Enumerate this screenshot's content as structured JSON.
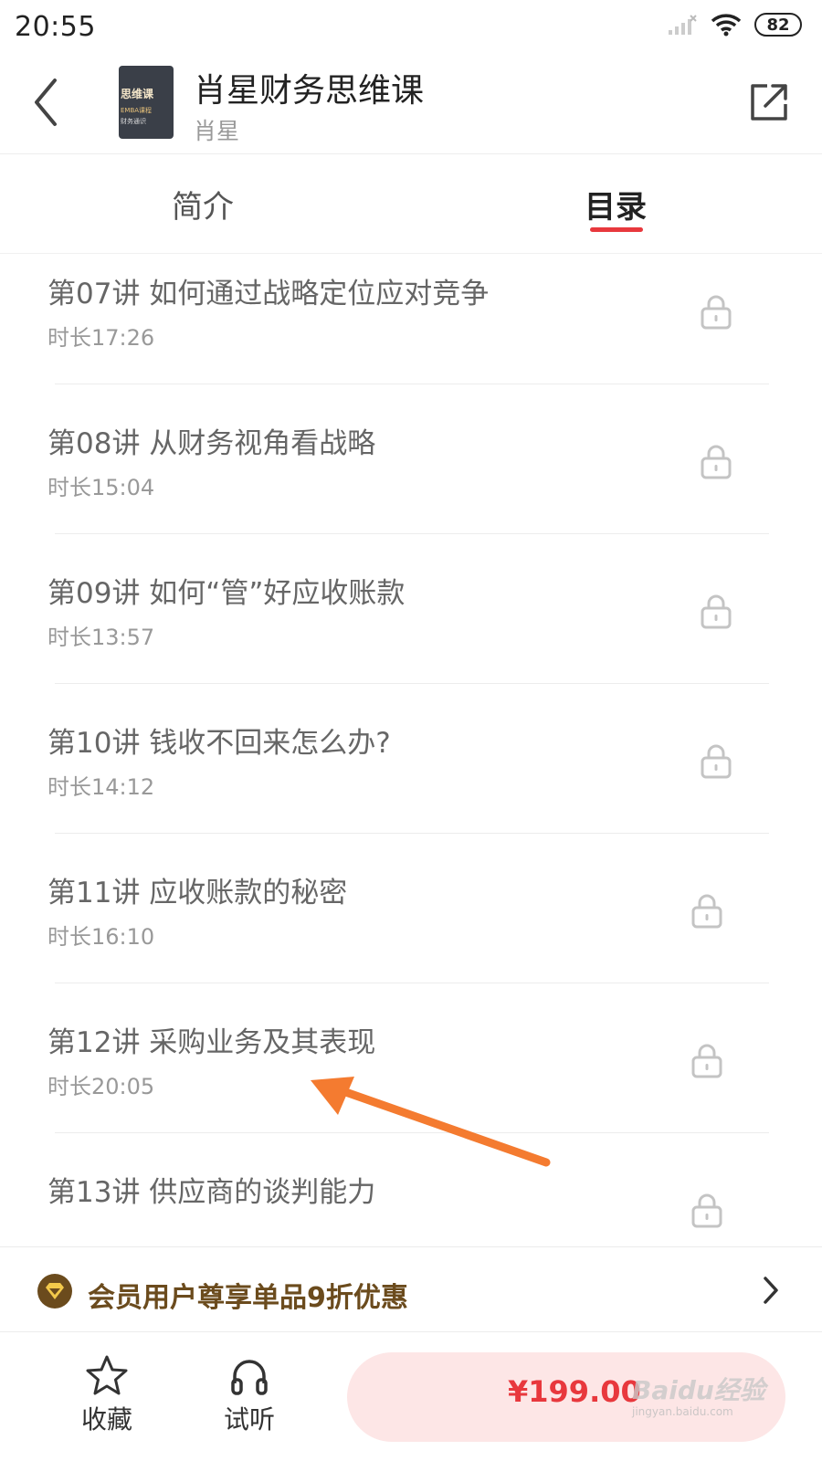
{
  "status_bar": {
    "time": "20:55",
    "battery": "82"
  },
  "header": {
    "title": "肖星财务思维课",
    "author": "肖星",
    "cover_lines": [
      "思维课",
      "EMBA课程",
      "财务通识"
    ]
  },
  "tabs": [
    {
      "label": "简介",
      "active": false
    },
    {
      "label": "目录",
      "active": true
    }
  ],
  "lessons": [
    {
      "title": "第07讲 如何通过战略定位应对竞争",
      "duration": "时长17:26",
      "locked": true
    },
    {
      "title": "第08讲 从财务视角看战略",
      "duration": "时长15:04",
      "locked": true
    },
    {
      "title": "第09讲 如何“管”好应收账款",
      "duration": "时长13:57",
      "locked": true
    },
    {
      "title": "第10讲 钱收不回来怎么办?",
      "duration": "时长14:12",
      "locked": true
    },
    {
      "title": "第11讲 应收账款的秘密",
      "duration": "时长16:10",
      "locked": true
    },
    {
      "title": "第12讲 采购业务及其表现",
      "duration": "时长20:05",
      "locked": true
    },
    {
      "title": "第13讲 供应商的谈判能力",
      "duration": "",
      "locked": true
    }
  ],
  "member_banner": {
    "text": "会员用户尊享单品9折优惠"
  },
  "bottom_bar": {
    "favorite_label": "收藏",
    "listen_label": "试听",
    "price": "¥199.00",
    "watermark": "Baidu经验",
    "watermark_sub": "jingyan.baidu.com"
  },
  "colors": {
    "accent": "#e8383d",
    "price_bg": "#fde6e6",
    "member_text": "#6b4b1d",
    "arrow": "#f47b30"
  }
}
